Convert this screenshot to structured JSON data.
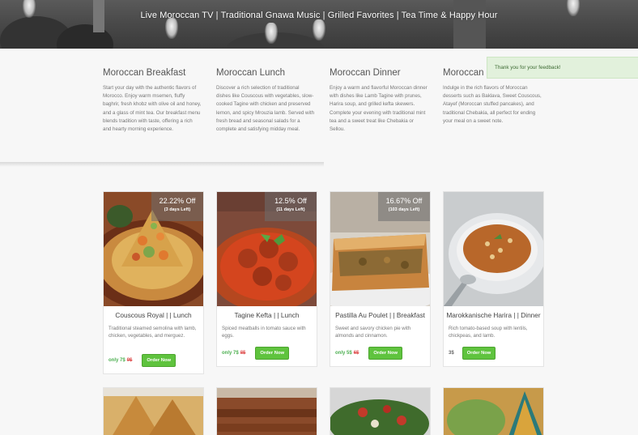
{
  "hero": {
    "banner_text": "Live Moroccan TV | Traditional Gnawa Music | Grilled Favorites | Tea Time & Happy Hour"
  },
  "toast": {
    "message": "Thank you for your feedback!"
  },
  "meals": [
    {
      "title": "Moroccan Breakfast",
      "text": "Start your day with the authentic flavors of Morocco. Enjoy warm msemen, fluffy baghrir, fresh khobz with olive oil and honey, and a glass of mint tea. Our breakfast menu blends tradition with taste, offering a rich and hearty morning experience."
    },
    {
      "title": "Moroccan Lunch",
      "text": "Discover a rich selection of traditional dishes like Couscous with vegetables, slow-cooked Tagine with chicken and preserved lemon, and spicy Mrouzia lamb. Served with fresh bread and seasonal salads for a complete and satisfying midday meal."
    },
    {
      "title": "Moroccan Dinner",
      "text": "Enjoy a warm and flavorful Moroccan dinner with dishes like Lamb Tagine with prunes, Harira soup, and grilled kefta skewers. Complete your evening with traditional mint tea and a sweet treat like Chebakia or Sellou."
    },
    {
      "title": "Moroccan",
      "text": "Indulge in the rich flavors of Moroccan desserts such as Baklava, Sweet Couscous, Atayef (Moroccan stuffed pancakes), and traditional Chebakia, all perfect for ending your meal on a sweet note."
    }
  ],
  "products": [
    {
      "name": "Couscous Royal | | Lunch",
      "desc": "Traditional steamed semolina with lamb, chicken, vegetables, and merguez.",
      "discount": "22.22% Off",
      "days": "(3 days Left)",
      "price_now": "only 7$",
      "price_old": "9$",
      "order_label": "Order Now"
    },
    {
      "name": "Tagine Kefta | | Lunch",
      "desc": "Spiced meatballs in tomato sauce with eggs.",
      "discount": "12.5% Off",
      "days": "(11 days Left)",
      "price_now": "only 7$",
      "price_old": "8$",
      "order_label": "Order Now"
    },
    {
      "name": "Pastilla Au Poulet | | Breakfast",
      "desc": "Sweet and savory chicken pie with almonds and cinnamon.",
      "discount": "16.67% Off",
      "days": "(103 days Left)",
      "price_now": "only 5$",
      "price_old": "6$",
      "order_label": "Order Now"
    },
    {
      "name": "Marokkanische Harira | | Dinner",
      "desc": "Rich tomato-based soup with lentils, chickpeas, and lamb.",
      "discount": "",
      "days": "",
      "price_now": "3$",
      "price_old": "",
      "order_label": "Order Now"
    }
  ],
  "colors": {
    "accent_green": "#5fc33e",
    "price_green": "#4caf50",
    "price_red": "#e05555",
    "toast_bg": "#e2f1dc"
  }
}
